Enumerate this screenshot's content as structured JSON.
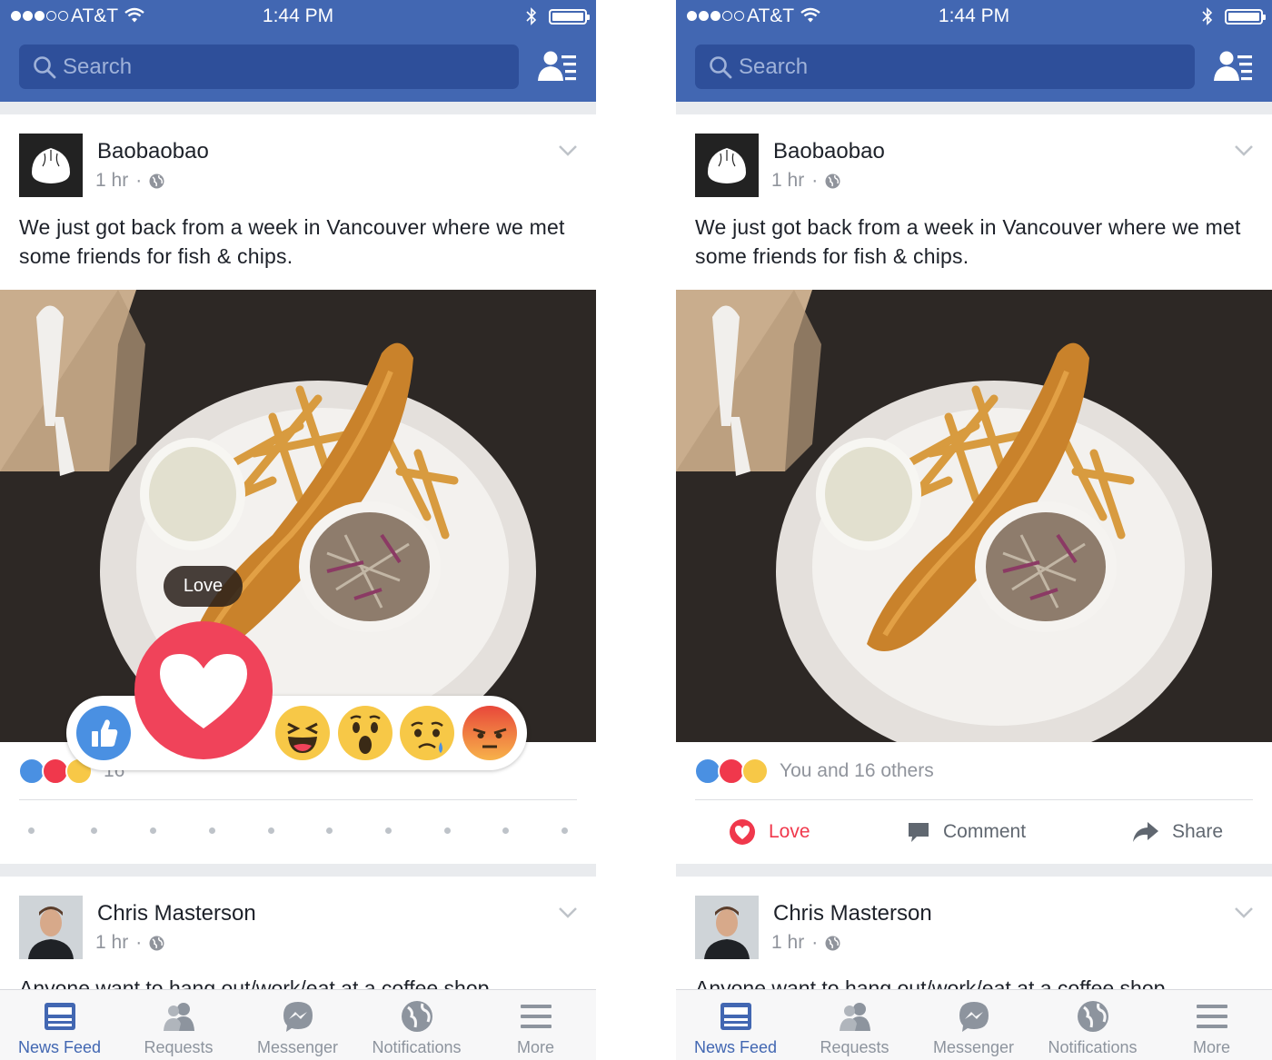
{
  "status_bar": {
    "carrier": "AT&T",
    "time": "1:44 PM"
  },
  "header": {
    "search_placeholder": "Search",
    "icons": [
      "search-icon",
      "friend-list-icon"
    ]
  },
  "post": {
    "author": "Baobaobao",
    "time": "1 hr",
    "separator": "·",
    "text": "We just got back from a week in Vancouver where we met some friends for fish & chips.",
    "reaction_count_partial": "16",
    "reaction_summary": "You and 16 others",
    "actions": {
      "love": "Love",
      "comment": "Comment",
      "share": "Share"
    }
  },
  "reaction_picker": {
    "tooltip": "Love",
    "reactions": [
      "like",
      "love",
      "haha",
      "wow",
      "sad",
      "angry"
    ],
    "selected": "love"
  },
  "post2": {
    "author": "Chris Masterson",
    "time": "1 hr",
    "separator": "·",
    "text_partial": "Anyone want to hang out/work/eat at a coffee shop"
  },
  "tabbar": {
    "tabs": [
      {
        "label": "News Feed",
        "icon": "news-feed-icon",
        "active": true
      },
      {
        "label": "Requests",
        "icon": "requests-icon",
        "active": false
      },
      {
        "label": "Messenger",
        "icon": "messenger-icon",
        "active": false
      },
      {
        "label": "Notifications",
        "icon": "globe-icon",
        "active": false
      },
      {
        "label": "More",
        "icon": "menu-icon",
        "active": false
      }
    ]
  },
  "colors": {
    "brand": "#4267b2",
    "love": "#f0384c",
    "like": "#4a90e2",
    "yellow": "#f7c847"
  }
}
